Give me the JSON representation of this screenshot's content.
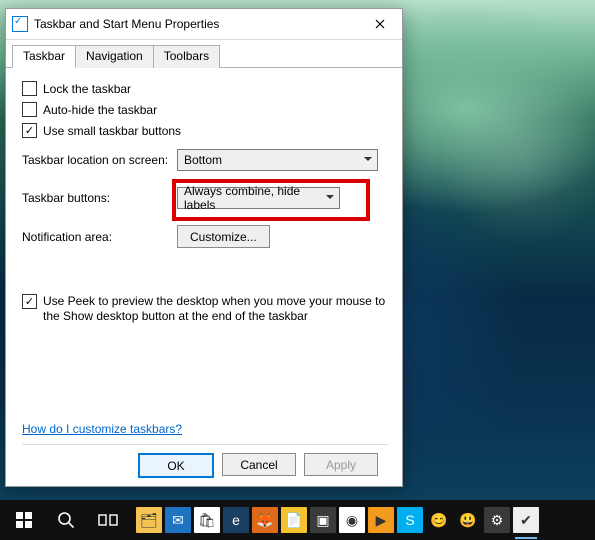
{
  "window": {
    "title": "Taskbar and Start Menu Properties"
  },
  "tabs": {
    "taskbar": "Taskbar",
    "navigation": "Navigation",
    "toolbars": "Toolbars"
  },
  "options": {
    "lock": {
      "label": "Lock the taskbar",
      "checked": false
    },
    "autohide": {
      "label": "Auto-hide the taskbar",
      "checked": false
    },
    "smallbtns": {
      "label": "Use small taskbar buttons",
      "checked": true
    }
  },
  "location": {
    "label": "Taskbar location on screen:",
    "value": "Bottom"
  },
  "buttons": {
    "label": "Taskbar buttons:",
    "value": "Always combine, hide labels"
  },
  "notification": {
    "label": "Notification area:",
    "button": "Customize..."
  },
  "peek": {
    "checked": true,
    "text": "Use Peek to preview the desktop when you move your mouse to the Show desktop button at the end of the taskbar"
  },
  "help_link": "How do I customize taskbars?",
  "dialog_buttons": {
    "ok": "OK",
    "cancel": "Cancel",
    "apply": "Apply"
  },
  "taskbar_apps": [
    {
      "name": "file-explorer",
      "bg": "#f3c453",
      "glyph": "🗂"
    },
    {
      "name": "mail",
      "bg": "#1e74c1",
      "glyph": "✉"
    },
    {
      "name": "store",
      "bg": "#ffffff",
      "glyph": "🛍"
    },
    {
      "name": "edge",
      "bg": "#1b3e63",
      "glyph": "e"
    },
    {
      "name": "firefox",
      "bg": "#e06a1c",
      "glyph": "🦊"
    },
    {
      "name": "notes",
      "bg": "#f4c430",
      "glyph": "📄"
    },
    {
      "name": "sublime",
      "bg": "#3b3b3b",
      "glyph": "▣"
    },
    {
      "name": "chrome",
      "bg": "#ffffff",
      "glyph": "◉"
    },
    {
      "name": "media-player",
      "bg": "#f29b1d",
      "glyph": "▶"
    },
    {
      "name": "skype",
      "bg": "#00aff0",
      "glyph": "S"
    },
    {
      "name": "emoji1",
      "bg": "#101010",
      "glyph": "😊"
    },
    {
      "name": "emoji2",
      "bg": "#101010",
      "glyph": "😃"
    },
    {
      "name": "settings-app",
      "bg": "#3a3a3a",
      "glyph": "⚙"
    },
    {
      "name": "taskbar-props",
      "bg": "#eeeeee",
      "glyph": "✔"
    }
  ]
}
